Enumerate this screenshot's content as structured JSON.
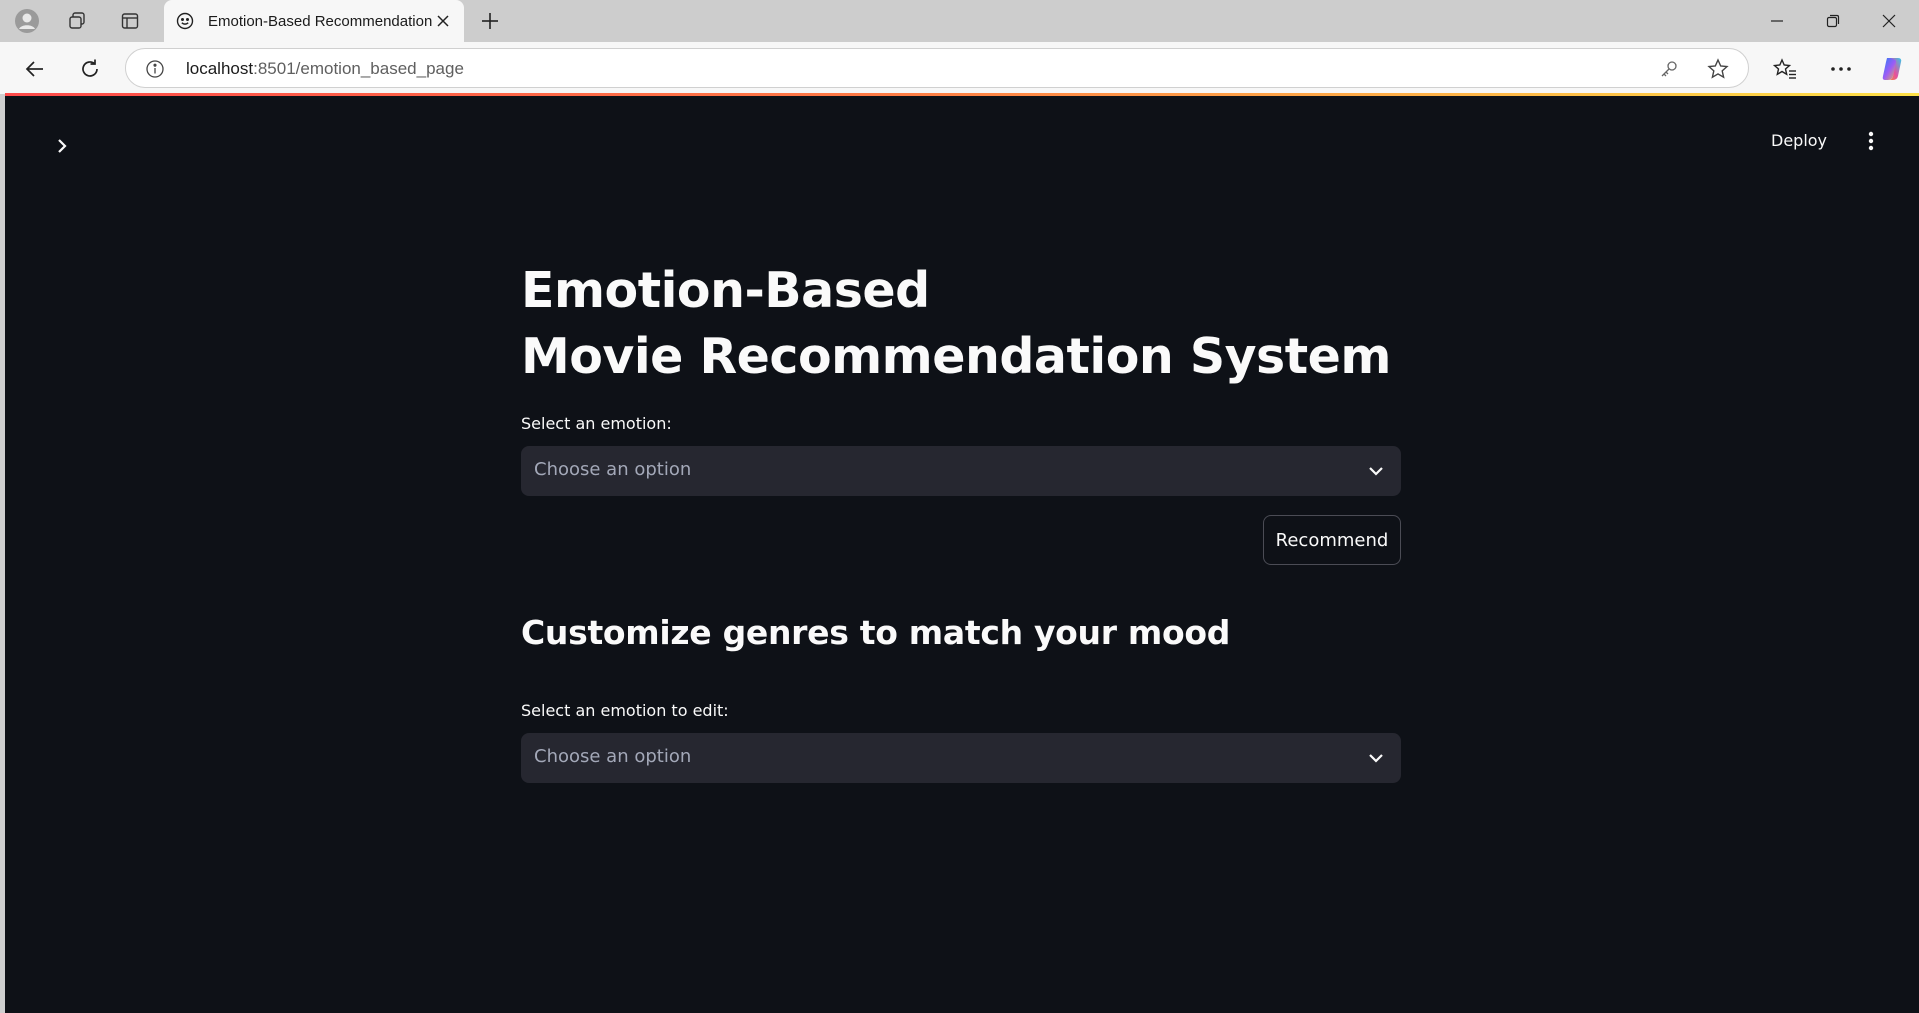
{
  "browser": {
    "tab_title": "Emotion-Based Recommendation",
    "url_host": "localhost",
    "url_path": ":8501/emotion_based_page"
  },
  "header": {
    "deploy_label": "Deploy"
  },
  "main": {
    "title_line1": "Emotion-Based",
    "title_line2": "Movie Recommendation System",
    "emotion_select": {
      "label": "Select an emotion:",
      "placeholder": "Choose an option"
    },
    "recommend_label": "Recommend",
    "section_title": "Customize genres to match your mood",
    "edit_select": {
      "label": "Select an emotion to edit:",
      "placeholder": "Choose an option"
    }
  },
  "colors": {
    "app_background": "#0e1117",
    "select_background": "#262730",
    "accent_red": "#ff4b4b",
    "accent_yellow": "#fde047"
  },
  "icons": [
    "profile-icon",
    "workspaces-icon",
    "tab-actions-icon",
    "smiley-favicon-icon",
    "close-icon",
    "plus-icon",
    "minimize-icon",
    "restore-icon",
    "window-close-icon",
    "back-icon",
    "refresh-icon",
    "info-icon",
    "key-icon",
    "star-icon",
    "favorites-icon",
    "more-icon",
    "copilot-icon",
    "chevron-right-icon",
    "kebab-menu-icon",
    "chevron-down-icon"
  ]
}
